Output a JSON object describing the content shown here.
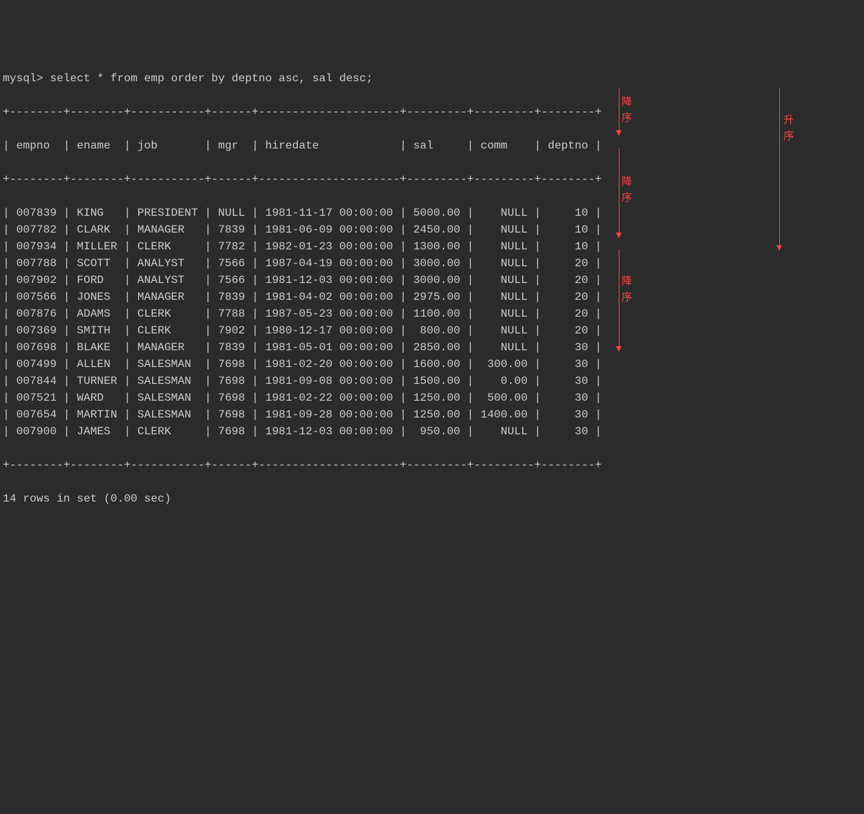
{
  "prompt": "mysql> ",
  "query": "select * from emp order by deptno asc, sal desc;",
  "border_top": "+--------+--------+-----------+------+---------------------+---------+---------+--------+",
  "header_row": "| empno  | ename  | job       | mgr  | hiredate            | sal     | comm    | deptno |",
  "columns": [
    "empno",
    "ename",
    "job",
    "mgr",
    "hiredate",
    "sal",
    "comm",
    "deptno"
  ],
  "rows": [
    {
      "empno": "007839",
      "ename": "KING",
      "job": "PRESIDENT",
      "mgr": "NULL",
      "hiredate": "1981-11-17 00:00:00",
      "sal": "5000.00",
      "comm": "NULL",
      "deptno": "10"
    },
    {
      "empno": "007782",
      "ename": "CLARK",
      "job": "MANAGER",
      "mgr": "7839",
      "hiredate": "1981-06-09 00:00:00",
      "sal": "2450.00",
      "comm": "NULL",
      "deptno": "10"
    },
    {
      "empno": "007934",
      "ename": "MILLER",
      "job": "CLERK",
      "mgr": "7782",
      "hiredate": "1982-01-23 00:00:00",
      "sal": "1300.00",
      "comm": "NULL",
      "deptno": "10"
    },
    {
      "empno": "007788",
      "ename": "SCOTT",
      "job": "ANALYST",
      "mgr": "7566",
      "hiredate": "1987-04-19 00:00:00",
      "sal": "3000.00",
      "comm": "NULL",
      "deptno": "20"
    },
    {
      "empno": "007902",
      "ename": "FORD",
      "job": "ANALYST",
      "mgr": "7566",
      "hiredate": "1981-12-03 00:00:00",
      "sal": "3000.00",
      "comm": "NULL",
      "deptno": "20"
    },
    {
      "empno": "007566",
      "ename": "JONES",
      "job": "MANAGER",
      "mgr": "7839",
      "hiredate": "1981-04-02 00:00:00",
      "sal": "2975.00",
      "comm": "NULL",
      "deptno": "20"
    },
    {
      "empno": "007876",
      "ename": "ADAMS",
      "job": "CLERK",
      "mgr": "7788",
      "hiredate": "1987-05-23 00:00:00",
      "sal": "1100.00",
      "comm": "NULL",
      "deptno": "20"
    },
    {
      "empno": "007369",
      "ename": "SMITH",
      "job": "CLERK",
      "mgr": "7902",
      "hiredate": "1980-12-17 00:00:00",
      "sal": "800.00",
      "comm": "NULL",
      "deptno": "20"
    },
    {
      "empno": "007698",
      "ename": "BLAKE",
      "job": "MANAGER",
      "mgr": "7839",
      "hiredate": "1981-05-01 00:00:00",
      "sal": "2850.00",
      "comm": "NULL",
      "deptno": "30"
    },
    {
      "empno": "007499",
      "ename": "ALLEN",
      "job": "SALESMAN",
      "mgr": "7698",
      "hiredate": "1981-02-20 00:00:00",
      "sal": "1600.00",
      "comm": "300.00",
      "deptno": "30"
    },
    {
      "empno": "007844",
      "ename": "TURNER",
      "job": "SALESMAN",
      "mgr": "7698",
      "hiredate": "1981-09-08 00:00:00",
      "sal": "1500.00",
      "comm": "0.00",
      "deptno": "30"
    },
    {
      "empno": "007521",
      "ename": "WARD",
      "job": "SALESMAN",
      "mgr": "7698",
      "hiredate": "1981-02-22 00:00:00",
      "sal": "1250.00",
      "comm": "500.00",
      "deptno": "30"
    },
    {
      "empno": "007654",
      "ename": "MARTIN",
      "job": "SALESMAN",
      "mgr": "7698",
      "hiredate": "1981-09-28 00:00:00",
      "sal": "1250.00",
      "comm": "1400.00",
      "deptno": "30"
    },
    {
      "empno": "007900",
      "ename": "JAMES",
      "job": "CLERK",
      "mgr": "7698",
      "hiredate": "1981-12-03 00:00:00",
      "sal": "950.00",
      "comm": "NULL",
      "deptno": "30"
    }
  ],
  "footer": "14 rows in set (0.00 sec)",
  "annotations": {
    "desc1": "降\n序",
    "desc2": "降\n序",
    "desc3": "降\n序",
    "asc": "升\n序"
  }
}
